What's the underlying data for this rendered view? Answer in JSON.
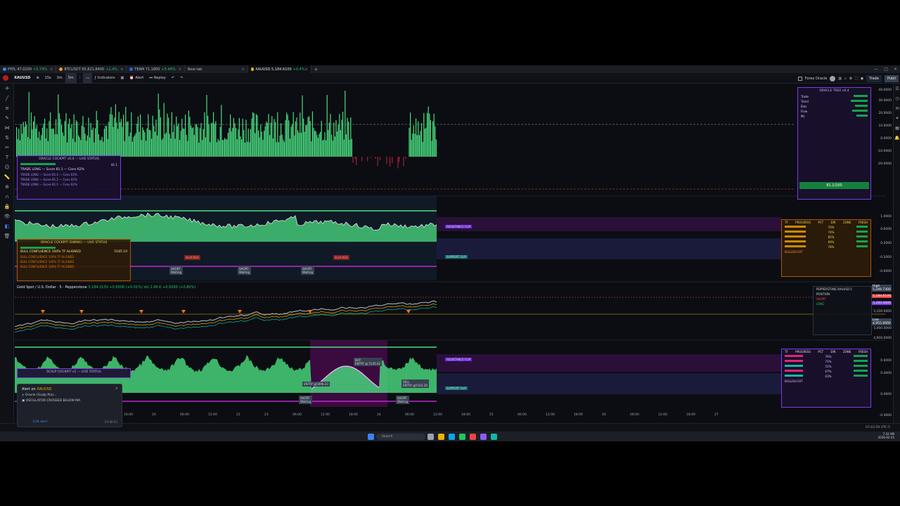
{
  "tabs": [
    {
      "symbol": "PYPL",
      "price": "47.0200",
      "change": "+5.74%",
      "color": "#3b82f6"
    },
    {
      "symbol": "BTCUSDT",
      "price": "65,821.8400",
      "change": "+1.4%",
      "color": "#f59e0b"
    },
    {
      "symbol": "TEAM",
      "price": "71.1800",
      "change": "+5.44%",
      "color": "#2563eb"
    },
    {
      "symbol": "New tab",
      "price": "",
      "change": "",
      "color": ""
    },
    {
      "symbol": "XAUUSD",
      "price": "5,184.6100",
      "change": "+0.4%",
      "color": "#eab308",
      "active": true
    }
  ],
  "toolbar": {
    "symbol": "XAUUSD",
    "intervals": [
      "15s",
      "3m",
      "5m"
    ],
    "indicators_label": "Indicators",
    "alert_label": "Alert",
    "replay_label": "Replay",
    "layout_name": "Forex Oracle",
    "trade_label": "Trade",
    "publish_label": "Publi"
  },
  "symbol_legend": {
    "title": "Gold Spot / U.S. Dollar · 5 · Pepperstone",
    "values": "5,184.3150 +0.6500 (+0.01%)",
    "vol": "Vol 1.06 K",
    "ohlc": "+0.9200 (+0.80%)"
  },
  "panels": {
    "oracle_tree": {
      "title": "ORACLE TREE v0.4",
      "score": "81.1/100",
      "rows": [
        "Trade",
        "Trend",
        "Bias",
        "Flow",
        "ML"
      ]
    },
    "cockpit1": {
      "title": "ORACLE COCKPIT v0.4 — LIVE STATUS",
      "headline": "TRADE LONG — Score 81.1 — Conv 62%",
      "rows": [
        "TRADE LONG — Score 81.4 — Conv 63%",
        "TRADE LONG — Score 81.2 — Conv 62%",
        "TRADE LONG — Score 81.1 — Conv 62%"
      ],
      "value": "81.1"
    },
    "cockpit2": {
      "title": "ORACLE COCKPIT (SWING) — LIVE STATUS",
      "headline": "BULL CONFLUENCE 100% TF ALIGNED",
      "value": "5185.10",
      "rows": [
        "BULL CONFLUENCE 100% TF ALIGNED",
        "BULL CONFLUENCE 100% TF ALIGNED",
        "BULL CONFLUENCE 100% TF ALIGNED"
      ]
    },
    "cockpit3": {
      "title": "SCALP COCKPIT v1 — LIVE STATUS"
    },
    "swing_table": {
      "headers": [
        "TF",
        "PROGRESS",
        "PCT",
        "DIR",
        "ZONE",
        "FRESH"
      ],
      "pcts": [
        "70%",
        "74%",
        "85%",
        "69%",
        "78%"
      ],
      "footer": "BULLISH EXT"
    },
    "scalp_table": {
      "headers": [
        "TF",
        "PROGRESS",
        "PCT",
        "DIR",
        "ZONE",
        "FRESH"
      ],
      "pcts": [
        "76%",
        "71%",
        "51%",
        "67%",
        "63%"
      ],
      "footer": "BULLISH EXT"
    },
    "position": {
      "title": "PEPPERSTONE:XAUUSD 5",
      "label": "POSITION",
      "short": "SHORT",
      "long": "LONG"
    }
  },
  "labels": {
    "blocked": "BLOCKED",
    "short_waiting": "SHORT\nWaiting",
    "buy": "BUY\nENTRY @ 5126.42",
    "sell": "SELL\nENTRY @5102.28",
    "entry": "ENTRY @5096.23",
    "resistance_flip": "RESISTANCE FLIP",
    "support_flip": "SUPPORT FLIP"
  },
  "price_scale": {
    "top": [
      "40.0000",
      "30.0000",
      "20.0000",
      "10.0000",
      "0.0000",
      "-10.0000",
      "-20.0000"
    ],
    "mid": [
      "1.0000",
      "0.6000",
      "0.2000",
      "-0.2000",
      "-0.6000"
    ],
    "price": [
      "5,200.0000",
      "5,184.6100",
      "5,100.0000",
      "5,000.0000",
      "4,900.0000"
    ],
    "bottom": [
      "0.6000",
      "0.4000",
      "0.0000",
      "-0.4000"
    ],
    "high_label": "High",
    "high_value": "5,249.7300",
    "low_label": "Low",
    "low_value": "4,955.6900"
  },
  "time_axis": [
    "18:00",
    "20",
    "06:00",
    "12:00",
    "22",
    "23",
    "06:00",
    "12:00",
    "18:00",
    "24",
    "06:00",
    "12:00",
    "18:00",
    "25",
    "06:00",
    "12:00",
    "18:00",
    "26",
    "06:00",
    "12:00",
    "18:00",
    "27"
  ],
  "status_time": "07:43:59 UTC-5",
  "taskbar": {
    "search": "Search",
    "clock_time": "7:43 AM",
    "clock_date": "2026-02-25"
  },
  "alert": {
    "title": "Alert on",
    "symbol": "XAUUSD",
    "line1": "Oracle (Scalp Pro)...",
    "line2": "OSCILLATOR CROSSED BELOW MA",
    "edit": "Edit alert",
    "time": "07:40:53"
  },
  "colors": {
    "green": "#4ade80",
    "red": "#ef4444",
    "purple": "#7c3aed",
    "magenta": "#c026d3",
    "teal": "#14b8a6"
  }
}
